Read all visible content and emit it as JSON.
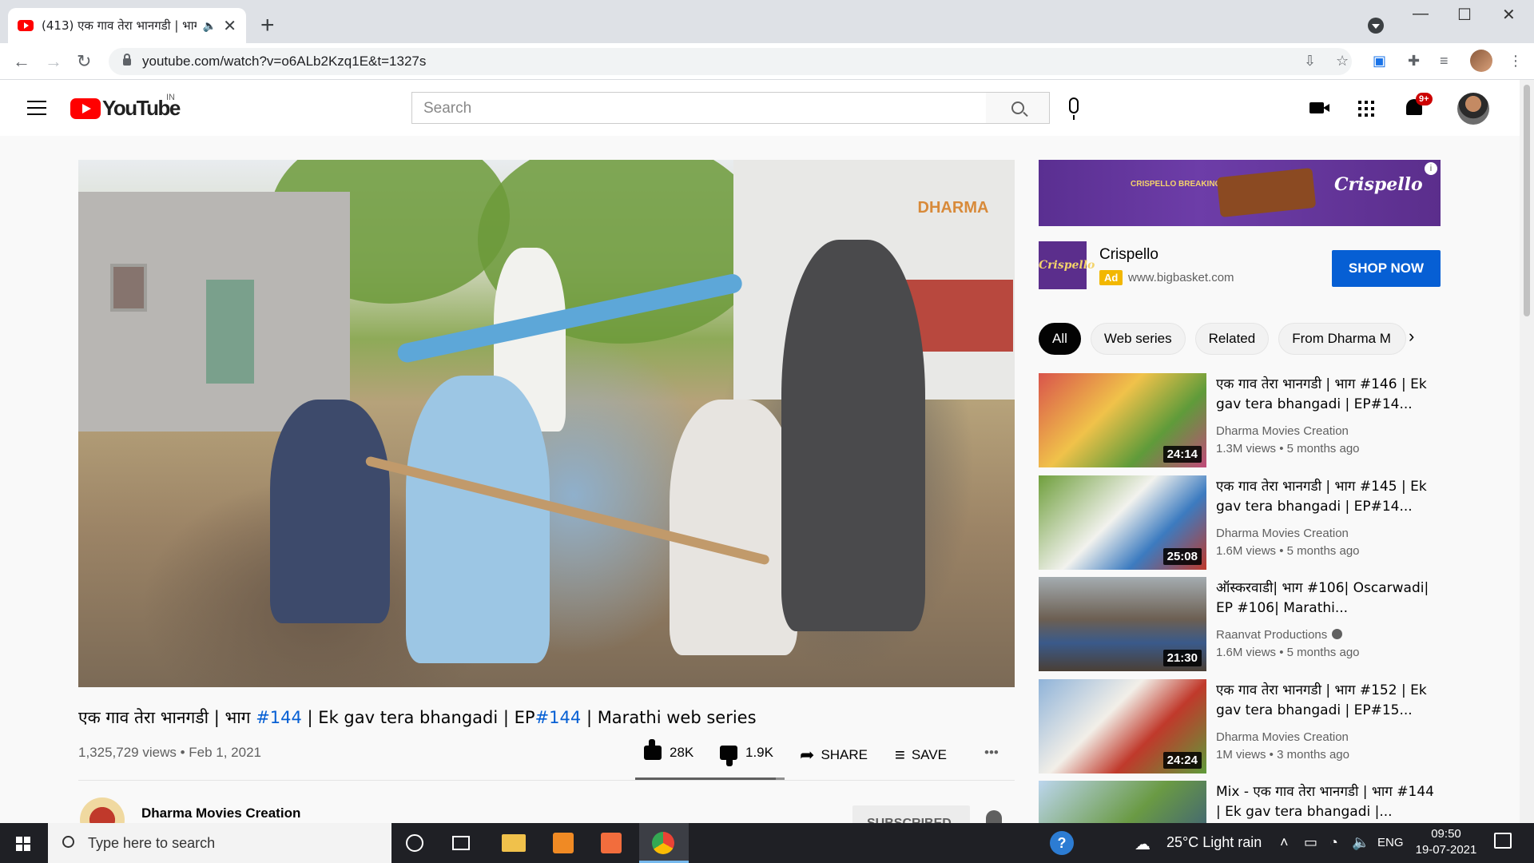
{
  "browser": {
    "tab_title": "(413) एक गाव तेरा भानगडी | भाग",
    "url": "youtube.com/watch?v=o6ALb2Kzq1E&t=1327s"
  },
  "youtube": {
    "logo_text": "YouTube",
    "country": "IN",
    "search_placeholder": "Search",
    "notif_badge": "9+"
  },
  "video": {
    "title_parts": [
      "एक गाव तेरा भानगडी | भाग ",
      "#144",
      " | Ek gav tera bhangadi | EP",
      "#144",
      " | Marathi web series"
    ],
    "views_date": "1,325,729 views • Feb 1, 2021",
    "likes": "28K",
    "dislikes": "1.9K",
    "share_label": "SHARE",
    "save_label": "SAVE",
    "more_label": "•••",
    "like_ratio": 0.94,
    "channel_name": "Dharma Movies Creation",
    "subscribe_label": "SUBSCRIBED",
    "watermark": "DHARMA"
  },
  "ad": {
    "banner_caption": "CRISPELLO BREAKING EQUAL SHARING",
    "banner_brand": "Crispello",
    "logo_text": "Crispello",
    "name": "Crispello",
    "tag": "Ad",
    "url": "www.bigbasket.com",
    "cta": "SHOP NOW",
    "info": "i"
  },
  "chips": [
    "All",
    "Web series",
    "Related",
    "From Dharma M"
  ],
  "recommendations": [
    {
      "title": "एक गाव तेरा भानगडी | भाग #146 | Ek gav tera bhangadi | EP#14...",
      "channel": "Dharma Movies Creation",
      "views": "1.3M views • 5 months ago",
      "duration": "24:14",
      "verified": false
    },
    {
      "title": "एक गाव तेरा भानगडी | भाग #145 | Ek gav tera bhangadi | EP#14...",
      "channel": "Dharma Movies Creation",
      "views": "1.6M views • 5 months ago",
      "duration": "25:08",
      "verified": false
    },
    {
      "title": "ऑस्करवाडी| भाग #106| Oscarwadi| EP #106| Marathi...",
      "channel": "Raanvat Productions",
      "views": "1.6M views • 5 months ago",
      "duration": "21:30",
      "verified": true
    },
    {
      "title": "एक गाव तेरा भानगडी | भाग #152 | Ek gav tera bhangadi | EP#15...",
      "channel": "Dharma Movies Creation",
      "views": "1M views • 3 months ago",
      "duration": "24:24",
      "verified": false
    },
    {
      "title": "Mix - एक गाव तेरा भानगडी | भाग #144 | Ek gav tera bhangadi |...",
      "channel": "",
      "views": "",
      "duration": "",
      "verified": false
    }
  ],
  "taskbar": {
    "search_placeholder": "Type here to search",
    "weather": "25°C  Light rain",
    "lang": "ENG",
    "time": "09:50",
    "date": "19-07-2021"
  },
  "colors": {
    "youtube_red": "#ff0000",
    "link_blue": "#065fd4",
    "ad_purple": "#5a2f91"
  }
}
